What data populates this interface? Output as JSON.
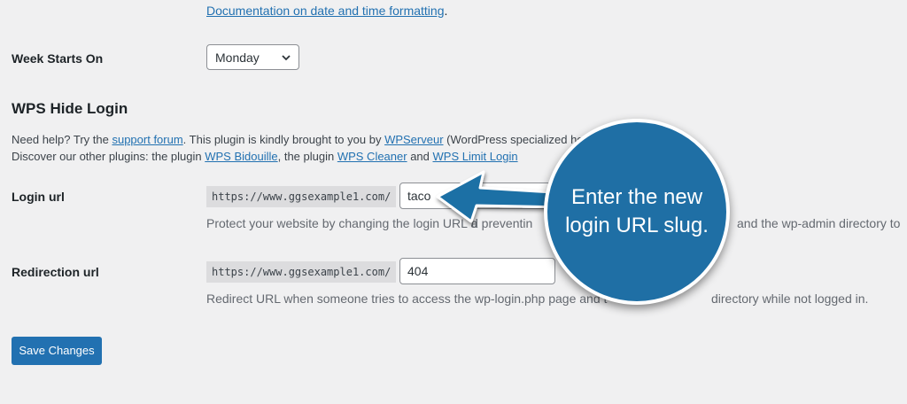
{
  "date_format": {
    "doc_link": "Documentation on date and time formatting",
    "trailing": "."
  },
  "week_start": {
    "label": "Week Starts On",
    "selected": "Monday"
  },
  "wps": {
    "title": "WPS Hide Login",
    "help_line1": {
      "prefix": "Need help? Try the ",
      "forum_link": "support forum",
      "mid": ". This plugin is kindly brought to you by ",
      "wpserveur_link": "WPServeur",
      "suffix": " (WordPress specialized ho"
    },
    "help_line2": {
      "prefix": "Discover our other plugins: the plugin ",
      "bidouille_link": "WPS Bidouille",
      "sep1": ", the plugin ",
      "cleaner_link": "WPS Cleaner",
      "sep2": " and ",
      "limit_link": "WPS Limit Login"
    },
    "login_url": {
      "label": "Login url",
      "prefix": "https://www.ggsexample1.com/",
      "value": "taco",
      "suffix_char": "/",
      "desc_left": "Protect your website by changing the login URL a",
      "desc_mid": "d preventin",
      "desc_right": "and the wp-admin directory to"
    },
    "redirect_url": {
      "label": "Redirection url",
      "prefix": "https://www.ggsexample1.com/",
      "value": "404",
      "suffix_char": "/",
      "desc_left": "Redirect URL when someone tries to access the wp-login.php page and t",
      "desc_right": "directory while not logged in."
    }
  },
  "save_button": "Save Changes",
  "callout": {
    "line1": "Enter the new",
    "line2": "login URL slug.",
    "color": "#1f6fa5"
  }
}
